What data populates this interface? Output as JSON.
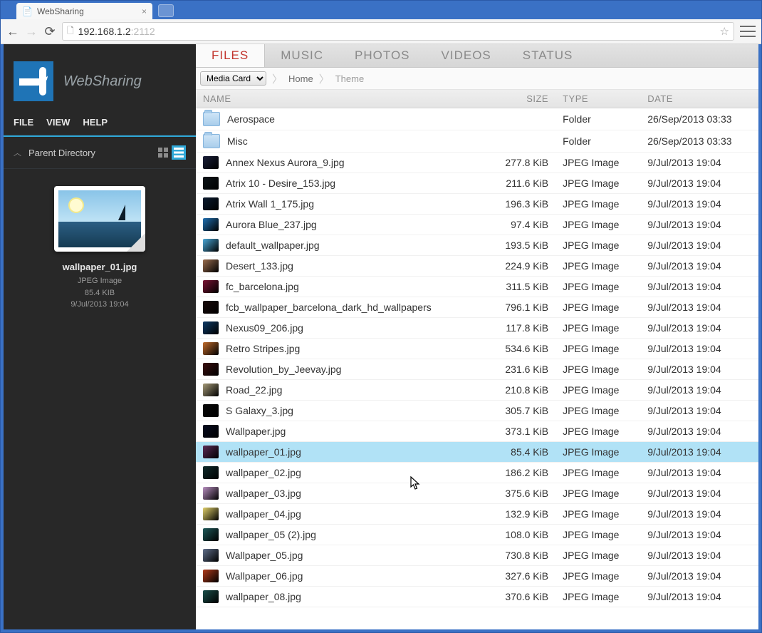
{
  "window": {
    "tab_title": "WebSharing",
    "url_strong": "192.168.1.2",
    "url_faded": ":2112"
  },
  "sidebar": {
    "app_name": "WebSharing",
    "menus": [
      "FILE",
      "VIEW",
      "HELP"
    ],
    "parent_dir": "Parent Directory",
    "preview": {
      "name": "wallpaper_01.jpg",
      "type": "JPEG Image",
      "size": "85.4 KIB",
      "date": "9/Jul/2013 19:04"
    }
  },
  "tabs": [
    "FILES",
    "MUSIC",
    "PHOTOS",
    "VIDEOS",
    "STATUS"
  ],
  "active_tab": 0,
  "breadcrumbs": {
    "source": "Media Card",
    "path": [
      "Home",
      "Theme"
    ]
  },
  "columns": {
    "name": "NAME",
    "size": "SIZE",
    "type": "TYPE",
    "date": "DATE"
  },
  "selected_row": 17,
  "rows": [
    {
      "icon": "folder",
      "name": "Aerospace",
      "size": "",
      "type": "Folder",
      "date": "26/Sep/2013 03:33",
      "ic": "#5a6b7a"
    },
    {
      "icon": "folder",
      "name": "Misc",
      "size": "",
      "type": "Folder",
      "date": "26/Sep/2013 03:33",
      "ic": "#5a6b7a"
    },
    {
      "icon": "img",
      "name": "Annex Nexus Aurora_9.jpg",
      "size": "277.8 KiB",
      "type": "JPEG Image",
      "date": "9/Jul/2013 19:04",
      "ic": "#1a1f3a"
    },
    {
      "icon": "img",
      "name": "Atrix 10 - Desire_153.jpg",
      "size": "211.6 KiB",
      "type": "JPEG Image",
      "date": "9/Jul/2013 19:04",
      "ic": "#0d1418"
    },
    {
      "icon": "img",
      "name": "Atrix Wall 1_175.jpg",
      "size": "196.3 KiB",
      "type": "JPEG Image",
      "date": "9/Jul/2013 19:04",
      "ic": "#0a1a2e"
    },
    {
      "icon": "img",
      "name": "Aurora Blue_237.jpg",
      "size": "97.4 KiB",
      "type": "JPEG Image",
      "date": "9/Jul/2013 19:04",
      "ic": "#1f6fb0"
    },
    {
      "icon": "img",
      "name": "default_wallpaper.jpg",
      "size": "193.5 KiB",
      "type": "JPEG Image",
      "date": "9/Jul/2013 19:04",
      "ic": "#4aa7d6"
    },
    {
      "icon": "img",
      "name": "Desert_133.jpg",
      "size": "224.9 KiB",
      "type": "JPEG Image",
      "date": "9/Jul/2013 19:04",
      "ic": "#9a6d4e"
    },
    {
      "icon": "img",
      "name": "fc_barcelona.jpg",
      "size": "311.5 KiB",
      "type": "JPEG Image",
      "date": "9/Jul/2013 19:04",
      "ic": "#7a1434"
    },
    {
      "icon": "img",
      "name": "fcb_wallpaper_barcelona_dark_hd_wallpapers",
      "size": "796.1 KiB",
      "type": "JPEG Image",
      "date": "9/Jul/2013 19:04",
      "ic": "#1a0b0b"
    },
    {
      "icon": "img",
      "name": "Nexus09_206.jpg",
      "size": "117.8 KiB",
      "type": "JPEG Image",
      "date": "9/Jul/2013 19:04",
      "ic": "#0d3a66"
    },
    {
      "icon": "img",
      "name": "Retro Stripes.jpg",
      "size": "534.6 KiB",
      "type": "JPEG Image",
      "date": "9/Jul/2013 19:04",
      "ic": "#c06a2a"
    },
    {
      "icon": "img",
      "name": "Revolution_by_Jeevay.jpg",
      "size": "231.6 KiB",
      "type": "JPEG Image",
      "date": "9/Jul/2013 19:04",
      "ic": "#3a0f0f"
    },
    {
      "icon": "img",
      "name": "Road_22.jpg",
      "size": "210.8 KiB",
      "type": "JPEG Image",
      "date": "9/Jul/2013 19:04",
      "ic": "#a59a78"
    },
    {
      "icon": "img",
      "name": "S Galaxy_3.jpg",
      "size": "305.7 KiB",
      "type": "JPEG Image",
      "date": "9/Jul/2013 19:04",
      "ic": "#090909"
    },
    {
      "icon": "img",
      "name": "Wallpaper.jpg",
      "size": "373.1 KiB",
      "type": "JPEG Image",
      "date": "9/Jul/2013 19:04",
      "ic": "#070b20"
    },
    {
      "icon": "img",
      "name": "wallpaper_01.jpg",
      "size": "85.4 KiB",
      "type": "JPEG Image",
      "date": "9/Jul/2013 19:04",
      "ic": "#5b2a56"
    },
    {
      "icon": "img",
      "name": "wallpaper_02.jpg",
      "size": "186.2 KiB",
      "type": "JPEG Image",
      "date": "9/Jul/2013 19:04",
      "ic": "#0f2a2a"
    },
    {
      "icon": "img",
      "name": "wallpaper_03.jpg",
      "size": "375.6 KiB",
      "type": "JPEG Image",
      "date": "9/Jul/2013 19:04",
      "ic": "#b88fc0"
    },
    {
      "icon": "img",
      "name": "wallpaper_04.jpg",
      "size": "132.9 KiB",
      "type": "JPEG Image",
      "date": "9/Jul/2013 19:04",
      "ic": "#e0cf6a"
    },
    {
      "icon": "img",
      "name": "wallpaper_05 (2).jpg",
      "size": "108.0 KiB",
      "type": "JPEG Image",
      "date": "9/Jul/2013 19:04",
      "ic": "#1f5a5a"
    },
    {
      "icon": "img",
      "name": "Wallpaper_05.jpg",
      "size": "730.8 KiB",
      "type": "JPEG Image",
      "date": "9/Jul/2013 19:04",
      "ic": "#5f6e8a"
    },
    {
      "icon": "img",
      "name": "Wallpaper_06.jpg",
      "size": "327.6 KiB",
      "type": "JPEG Image",
      "date": "9/Jul/2013 19:04",
      "ic": "#b03a1a"
    },
    {
      "icon": "img",
      "name": "wallpaper_08.jpg",
      "size": "370.6 KiB",
      "type": "JPEG Image",
      "date": "9/Jul/2013 19:04",
      "ic": "#1a4f4a"
    }
  ]
}
